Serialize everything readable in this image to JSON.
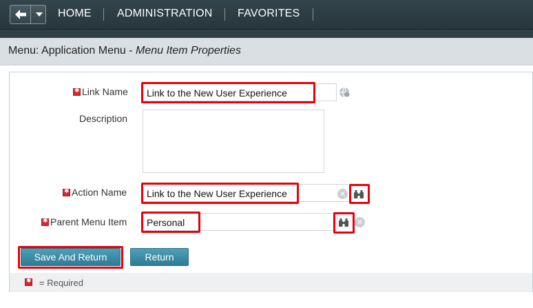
{
  "nav": {
    "home": "HOME",
    "administration": "ADMINISTRATION",
    "favorites": "FAVORITES"
  },
  "header": {
    "prefix": "Menu: Application Menu - ",
    "subtitle": "Menu Item Properties"
  },
  "form": {
    "link_name_label": "Link Name",
    "link_name_value": "Link to the New User Experience",
    "description_label": "Description",
    "description_value": "",
    "action_name_label": "Action Name",
    "action_name_value": "Link to the New User Experience",
    "parent_menu_label": "Parent Menu Item",
    "parent_menu_value": "Personal"
  },
  "buttons": {
    "save_and_return": "Save And Return",
    "return": "Return"
  },
  "footer": {
    "required_note": "= Required"
  },
  "colors": {
    "highlight": "#e6000b",
    "button": "#3a8ca8",
    "topbar": "#2f3e45",
    "required": "#d8262e"
  }
}
